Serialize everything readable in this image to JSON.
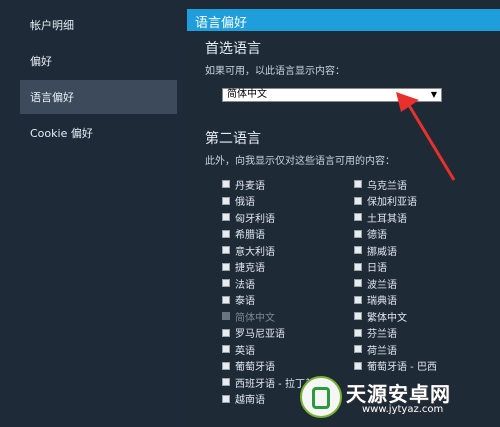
{
  "sidebar": {
    "items": [
      {
        "label": "帐户明细"
      },
      {
        "label": "偏好"
      },
      {
        "label": "语言偏好"
      },
      {
        "label": "Cookie 偏好"
      }
    ]
  },
  "main": {
    "header_title": "语言偏好",
    "primary": {
      "heading": "首选语言",
      "description": "如果可用，以此语言显示内容：",
      "selected": "简体中文"
    },
    "secondary": {
      "heading": "第二语言",
      "description": "此外，向我显示仅对这些语言可用的内容：",
      "left_column": [
        "丹麦语",
        "俄语",
        "匈牙利语",
        "希腊语",
        "意大利语",
        "捷克语",
        "法语",
        "泰语",
        "简体中文",
        "罗马尼亚语",
        "英语",
        "葡萄牙语",
        "西班牙语 - 拉丁美洲",
        "越南语"
      ],
      "right_column": [
        "乌克兰语",
        "保加利亚语",
        "土耳其语",
        "德语",
        "挪威语",
        "日语",
        "波兰语",
        "瑞典语",
        "繁体中文",
        "芬兰语",
        "荷兰语",
        "葡萄牙语 - 巴西"
      ],
      "disabled": "简体中文"
    }
  },
  "watermark": {
    "text": "天源安卓网",
    "url": "www.jytyaz.com"
  },
  "colors": {
    "accent": "#1e9fdb",
    "annotation_arrow": "#e8302c"
  }
}
